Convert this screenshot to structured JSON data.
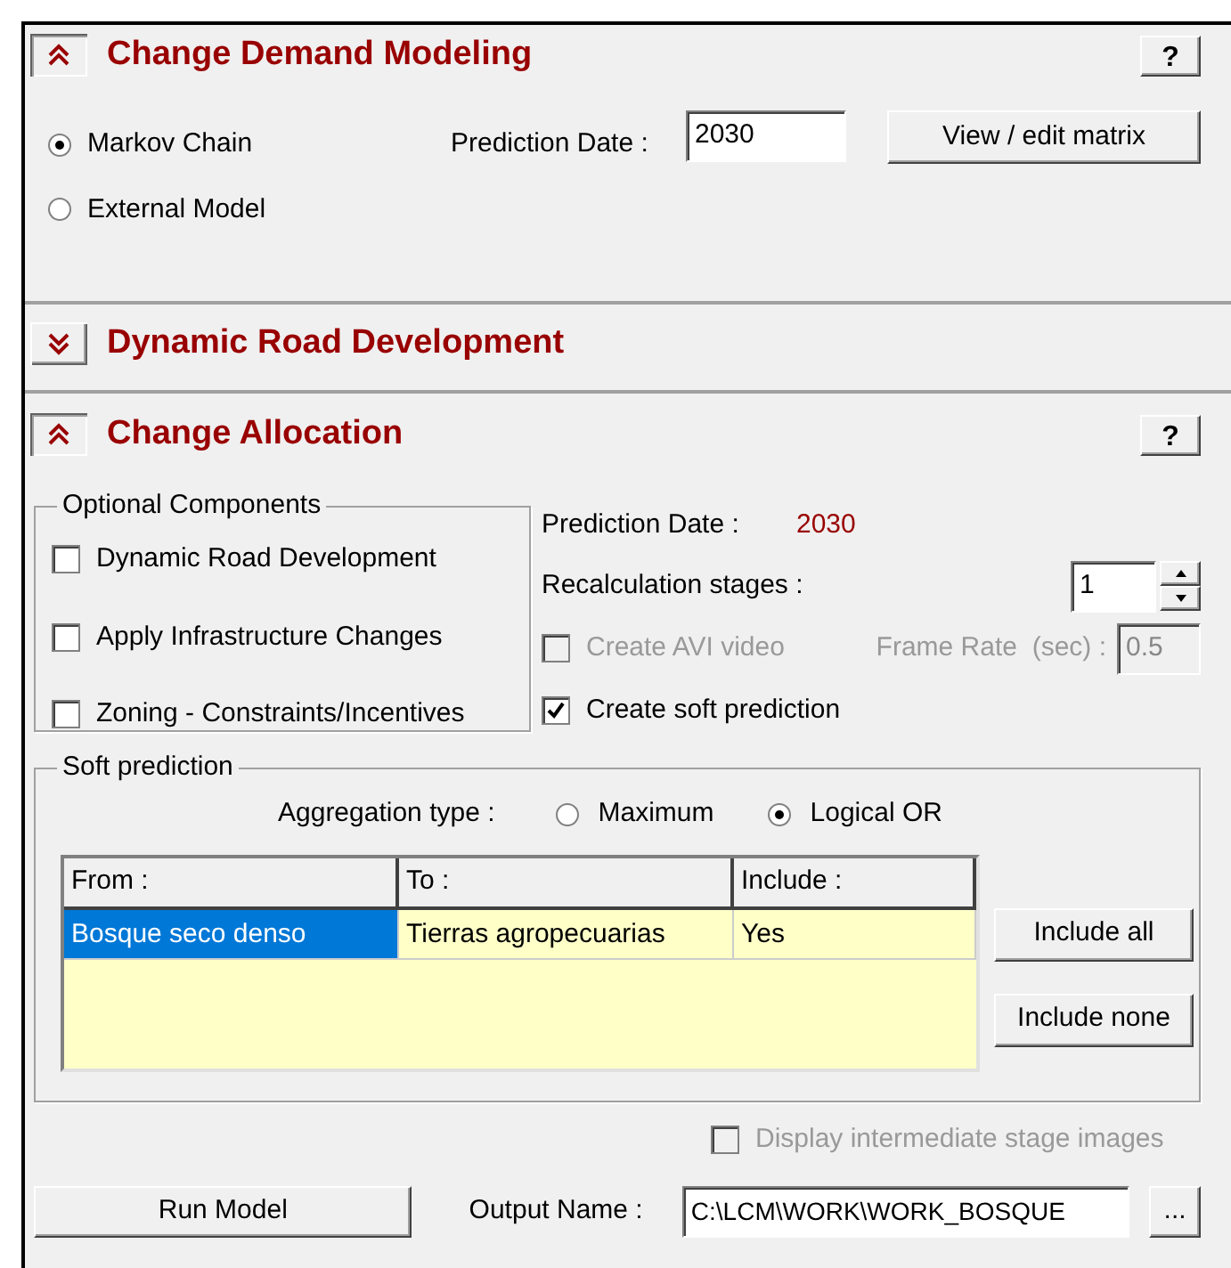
{
  "demand_modeling": {
    "title": "Change Demand Modeling",
    "expanded": true,
    "help_button": "?",
    "model_options": [
      {
        "label": "Markov Chain",
        "selected": true
      },
      {
        "label": "External Model",
        "selected": false
      }
    ],
    "prediction_date_label": "Prediction Date :",
    "prediction_date": "2030",
    "matrix_button": "View / edit matrix"
  },
  "road_development": {
    "title": "Dynamic Road Development",
    "expanded": false
  },
  "change_allocation": {
    "title": "Change Allocation",
    "expanded": true,
    "help_button": "?",
    "optional_components": {
      "title": "Optional Components",
      "items": [
        {
          "label": "Dynamic Road Development",
          "checked": false
        },
        {
          "label": "Apply Infrastructure Changes",
          "checked": false
        },
        {
          "label": "Zoning - Constraints/Incentives",
          "checked": false
        }
      ]
    },
    "prediction_date_label": "Prediction Date :",
    "prediction_date": "2030",
    "recalculation_label": "Recalculation stages :",
    "recalculation_stages": "1",
    "avi_video": {
      "label": "Create AVI video",
      "checked": false,
      "disabled": true
    },
    "frame_rate": {
      "label": "Frame Rate  (sec) :",
      "value": "0.5",
      "disabled": true
    },
    "soft_prediction_option": {
      "label": "Create soft prediction",
      "checked": true
    }
  },
  "soft_prediction": {
    "title": "Soft prediction",
    "aggregation_label": "Aggregation type :",
    "aggregation_options": [
      {
        "label": "Maximum",
        "selected": false
      },
      {
        "label": "Logical OR",
        "selected": true
      }
    ],
    "table": {
      "columns": [
        "From :",
        "To :",
        "Include :"
      ],
      "rows": [
        {
          "cells": [
            "Bosque seco denso",
            "Tierras agropecuarias",
            "Yes"
          ],
          "selected": true
        }
      ]
    },
    "buttons": [
      "Include all",
      "Include none"
    ]
  },
  "display_intermediate": {
    "label": "Display intermediate stage images",
    "checked": false,
    "disabled": true
  },
  "run_button": "Run Model",
  "output_label": "Output Name :",
  "output_name": "C:\\LCM\\WORK\\WORK_BOSQUE",
  "browse_button": "..."
}
